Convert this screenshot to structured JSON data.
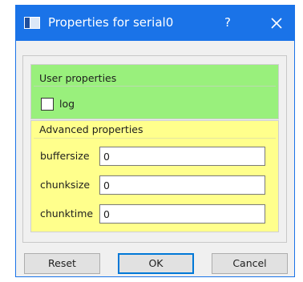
{
  "window": {
    "title": "Properties for serial0",
    "help_label": "?",
    "accent_color": "#1a73e8"
  },
  "icons": {
    "app": "properties-window-icon",
    "close": "close-icon"
  },
  "user_group": {
    "title": "User properties",
    "color": "#99f07c",
    "log": {
      "label": "log",
      "checked": false
    }
  },
  "advanced_group": {
    "title": "Advanced properties",
    "color": "#ffff8c",
    "fields": [
      {
        "label": "buffersize",
        "value": "0"
      },
      {
        "label": "chunksize",
        "value": "0"
      },
      {
        "label": "chunktime",
        "value": "0"
      }
    ]
  },
  "buttons": {
    "reset": "Reset",
    "ok": "OK",
    "cancel": "Cancel"
  }
}
